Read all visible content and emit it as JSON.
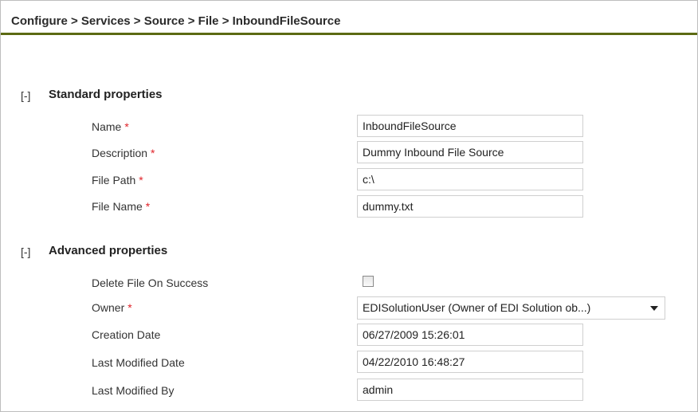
{
  "breadcrumb": "Configure > Services > Source > File > InboundFileSource",
  "sections": {
    "standard": {
      "toggle": "[-]",
      "title": "Standard properties"
    },
    "advanced": {
      "toggle": "[-]",
      "title": "Advanced properties"
    }
  },
  "required_marker": "*",
  "fields": {
    "name": {
      "label": "Name",
      "value": "InboundFileSource"
    },
    "description": {
      "label": "Description",
      "value": "Dummy Inbound File Source"
    },
    "file_path": {
      "label": "File Path",
      "value": "c:\\"
    },
    "file_name": {
      "label": "File Name",
      "value": "dummy.txt"
    },
    "delete_on_success": {
      "label": "Delete File On Success",
      "checked": false
    },
    "owner": {
      "label": "Owner",
      "value": "EDISolutionUser (Owner of EDI Solution ob...)"
    },
    "creation_date": {
      "label": "Creation Date",
      "value": "06/27/2009 15:26:01"
    },
    "last_modified_date": {
      "label": "Last Modified Date",
      "value": "04/22/2010 16:48:27"
    },
    "last_modified_by": {
      "label": "Last Modified By",
      "value": "admin"
    }
  },
  "colors": {
    "title_rule": "#5c6a13",
    "required": "#e0232a"
  },
  "icons": {
    "dropdown": "chevron-down-icon"
  }
}
